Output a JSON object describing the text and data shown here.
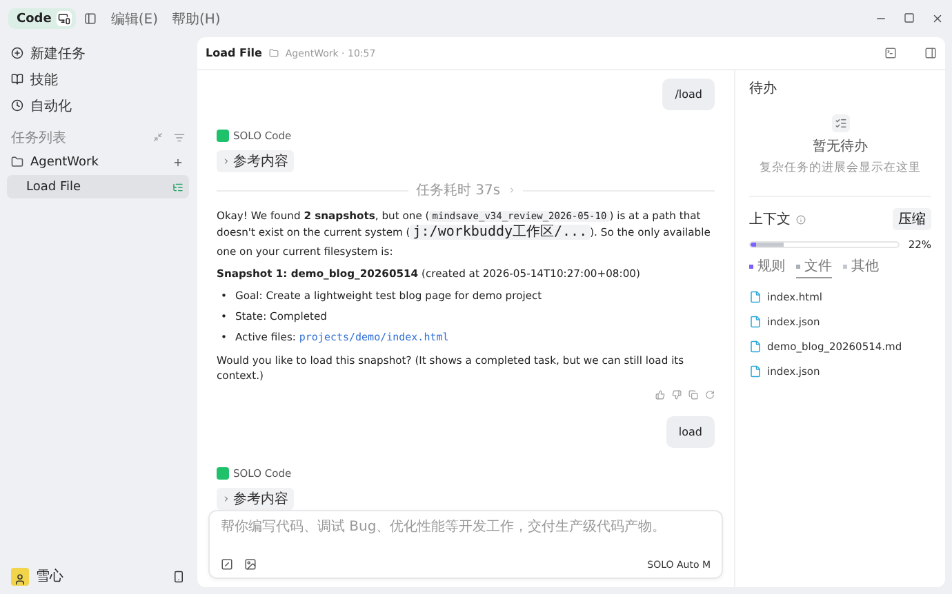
{
  "topbar": {
    "mode": {
      "label": "Code",
      "selected": true
    },
    "menus": [
      "编辑(E)",
      "帮助(H)"
    ]
  },
  "sidebar": {
    "nav": [
      {
        "kind": "new",
        "label": "新建任务"
      },
      {
        "kind": "skills",
        "label": "技能"
      },
      {
        "kind": "clock",
        "label": "自动化"
      }
    ],
    "section_title": "任务列表",
    "tree": [
      {
        "label": "AgentWork",
        "selected": false,
        "children": [
          {
            "label": "Load File",
            "selected": true
          }
        ]
      }
    ],
    "user": {
      "name": "雪心"
    }
  },
  "conversation": {
    "title": "Load File",
    "workspace": "AgentWork · 10:57",
    "messages": [
      {
        "kind": "user",
        "text": "/load"
      },
      {
        "kind": "agent",
        "name": "SOLO Code",
        "chip": "参考内容"
      },
      {
        "kind": "divider",
        "text": "任务耗时 37s"
      },
      {
        "kind": "answer",
        "blocks": [
          {
            "kind": "paragraph",
            "segments": [
              {
                "kind": "text",
                "text": "Okay! We found **2 snapshots**, but one ("
              },
              {
                "kind": "code",
                "text": "mindsave_v34_review_2026-05-10"
              },
              {
                "kind": "text",
                "text": ") is at a path that doesn't exist on the current system ("
              },
              {
                "kind": "code",
                "text": "j:/workbuddy工作区/..."
              },
              {
                "kind": "text",
                "text": "). So the only available one on your current filesystem is:"
              }
            ]
          },
          {
            "kind": "paragraph",
            "segments": [
              {
                "kind": "text",
                "text": "**Snapshot 1: demo_blog_20260514** (created at 2026-05-14T10:27:00+08:00)"
              }
            ]
          },
          {
            "kind": "bullets",
            "marker": "•",
            "items": [
              [
                {
                  "kind": "text",
                  "text": "Goal: Create a lightweight test blog page for demo project"
                }
              ],
              [
                {
                  "kind": "text",
                  "text": "State: Completed"
                }
              ],
              [
                {
                  "kind": "text",
                  "text": "Active files: "
                },
                {
                  "kind": "link",
                  "text": "projects/demo/index.html"
                }
              ]
            ]
          },
          {
            "kind": "paragraph",
            "segments": [
              {
                "kind": "text",
                "text": "Would you like to load this snapshot? (It shows a completed task, but we can still load its context.)"
              }
            ]
          }
        ]
      },
      {
        "kind": "user",
        "text": "load"
      },
      {
        "kind": "agent",
        "name": "SOLO Code",
        "chip": "参考内容"
      }
    ],
    "composer": {
      "placeholder": "帮你编写代码、调试 Bug、优化性能等开发工作，交付生产级代码产物。",
      "mode": "SOLO Auto M"
    }
  },
  "panel": {
    "todo": {
      "title": "待办",
      "empty_title": "暂无待办",
      "empty_hint": "复杂任务的进展会显示在这里"
    },
    "context": {
      "title": "上下文",
      "compress": "压缩",
      "level": 0.22,
      "reading": "22%",
      "legend": [
        {
          "label": "规则",
          "color": "#7b61ff",
          "selected": false
        },
        {
          "label": "文件",
          "color": "#aab0b8",
          "selected": true
        },
        {
          "label": "其他",
          "color": "#c4c8ce",
          "selected": false
        }
      ],
      "files": [
        {
          "name": "index.html"
        },
        {
          "name": "index.json"
        },
        {
          "name": "demo_blog_20260514.md"
        },
        {
          "name": "index.json"
        }
      ]
    }
  }
}
